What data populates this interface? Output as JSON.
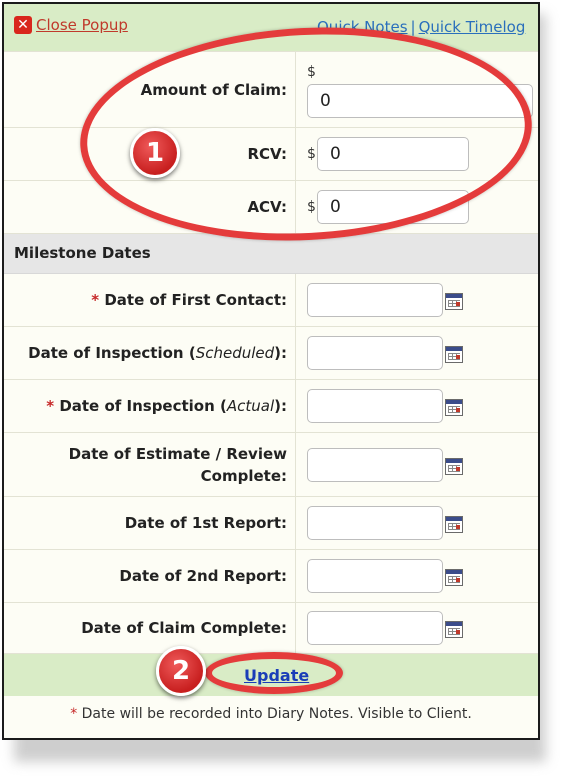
{
  "header": {
    "close_label": "Close Popup",
    "quick_notes": "Quick Notes",
    "separator": "|",
    "quick_timelog": "Quick Timelog"
  },
  "claim_fields": {
    "currency_symbol": "$",
    "amount": {
      "label": "Amount of Claim:",
      "value": "0"
    },
    "rcv": {
      "label": "RCV:",
      "value": "0"
    },
    "acv": {
      "label": "ACV:",
      "value": "0"
    }
  },
  "milestones": {
    "title": "Milestone Dates",
    "required_mark": "*",
    "first_contact": {
      "label": "Date of First Contact:",
      "value": ""
    },
    "inspection_scheduled": {
      "label_a": "Date of Inspection (",
      "label_em": "Scheduled",
      "label_b": "):",
      "value": ""
    },
    "inspection_actual": {
      "label_a": "Date of Inspection (",
      "label_em": "Actual",
      "label_b": "):",
      "value": ""
    },
    "estimate_review": {
      "label_line1": "Date of Estimate / Review",
      "label_line2": "Complete:",
      "value": ""
    },
    "first_report": {
      "label": "Date of 1st Report:",
      "value": ""
    },
    "second_report": {
      "label": "Date of 2nd Report:",
      "value": ""
    },
    "claim_complete": {
      "label": "Date of Claim Complete:",
      "value": ""
    }
  },
  "update_label": "Update",
  "footnote": {
    "mark": "*",
    "text": " Date will be recorded into Diary Notes. Visible to Client."
  },
  "annotations": {
    "marker_1": "1",
    "marker_2": "2",
    "color": "#e43b3b"
  },
  "icons": [
    "close-icon",
    "calendar-icon"
  ]
}
